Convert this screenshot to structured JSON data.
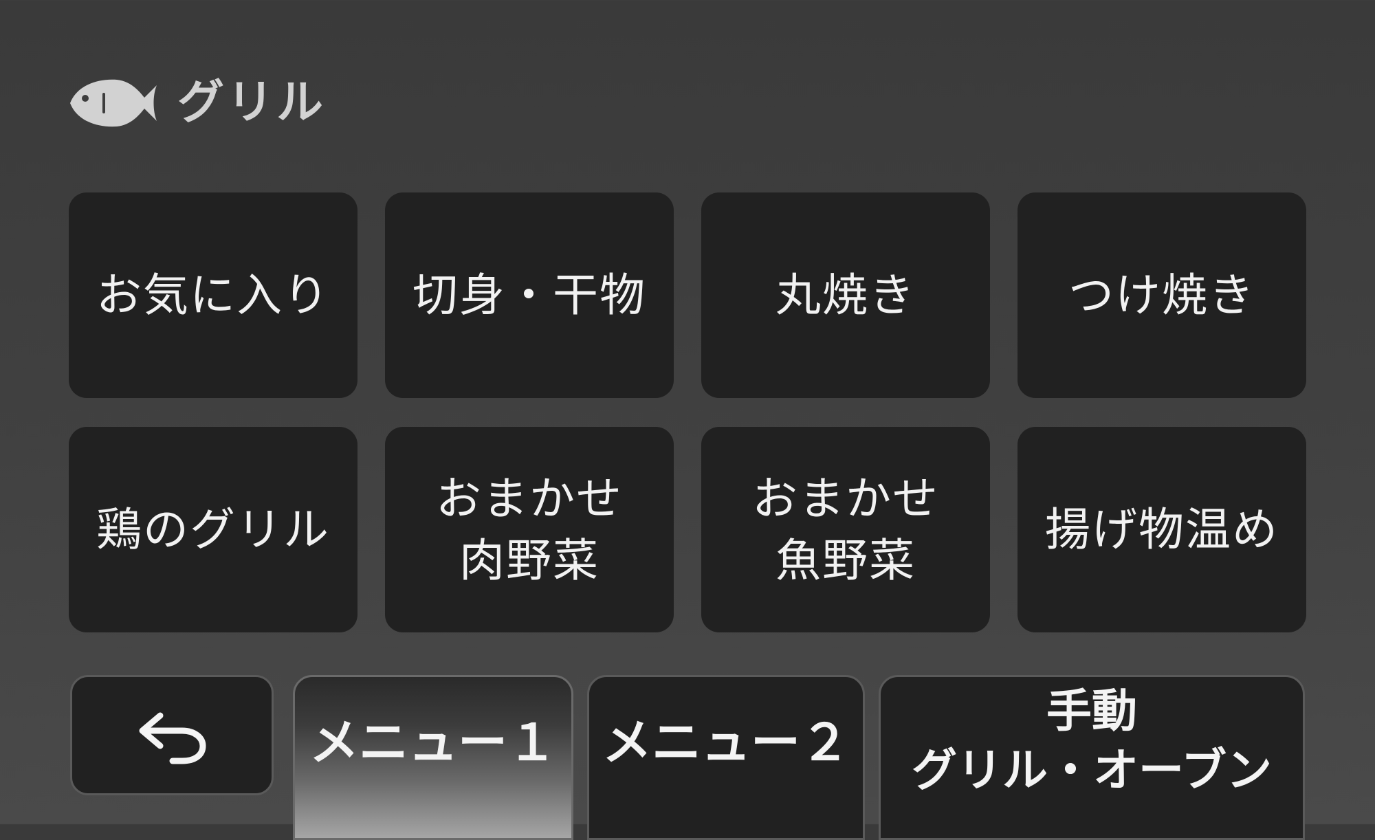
{
  "header": {
    "icon": "fish-icon",
    "title": "グリル"
  },
  "tiles": [
    {
      "lines": [
        "お気に入り"
      ]
    },
    {
      "lines": [
        "切身・干物"
      ]
    },
    {
      "lines": [
        "丸焼き"
      ]
    },
    {
      "lines": [
        "つけ焼き"
      ]
    },
    {
      "lines": [
        "鶏のグリル"
      ]
    },
    {
      "lines": [
        "おまかせ",
        "肉野菜"
      ]
    },
    {
      "lines": [
        "おまかせ",
        "魚野菜"
      ]
    },
    {
      "lines": [
        "揚げ物温め"
      ]
    }
  ],
  "bottom_bar": {
    "back_icon": "back-arrow-icon",
    "menu1_label": "メニュー１",
    "menu2_label": "メニュー２",
    "manual_line1": "手動",
    "manual_line2": "グリル・オーブン"
  },
  "colors": {
    "background": "#414141",
    "tile": "#212121",
    "text": "#f2f2f2",
    "header_text": "#d2d2d2"
  }
}
